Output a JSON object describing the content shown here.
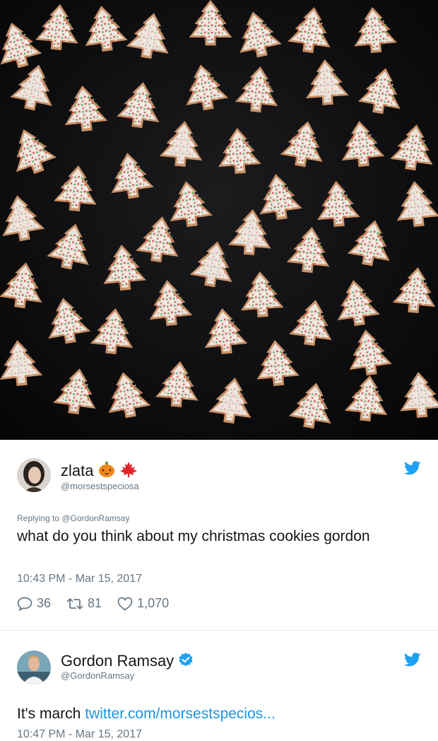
{
  "photo": {
    "description_icon": "cookie-photo"
  },
  "tweet1": {
    "name": "zlata",
    "emojis": [
      "pumpkin-icon",
      "maple-leaf-icon"
    ],
    "handle": "@morsestspeciosa",
    "replying": "Replying to @GordonRamsay",
    "text": "what do you think about my christmas cookies gordon",
    "time": "10:43 PM - Mar 15, 2017",
    "replies": "36",
    "retweets": "81",
    "likes": "1,070"
  },
  "tweet2": {
    "name": "Gordon Ramsay",
    "verified_icon": "verified-badge-icon",
    "handle": "@GordonRamsay",
    "text_prefix": "It's march ",
    "link": "twitter.com/morsestspecios...",
    "time": "10:47 PM - Mar 15, 2017"
  },
  "colors": {
    "link": "#1b95e0",
    "twitter_blue": "#1da1f2",
    "muted": "#657786"
  }
}
